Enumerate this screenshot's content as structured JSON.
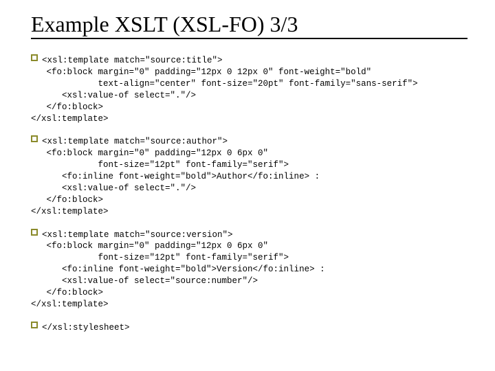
{
  "title": "Example XSLT (XSL-FO) 3/3",
  "blocks": [
    {
      "lines": [
        "<xsl:template match=\"source:title\">",
        "   <fo:block margin=\"0\" padding=\"12px 0 12px 0\" font-weight=\"bold\"",
        "             text-align=\"center\" font-size=\"20pt\" font-family=\"sans-serif\">",
        "      <xsl:value-of select=\".\"/>",
        "   </fo:block>",
        "</xsl:template>"
      ]
    },
    {
      "lines": [
        "<xsl:template match=\"source:author\">",
        "   <fo:block margin=\"0\" padding=\"12px 0 6px 0\"",
        "             font-size=\"12pt\" font-family=\"serif\">",
        "      <fo:inline font-weight=\"bold\">Author</fo:inline> :",
        "      <xsl:value-of select=\".\"/>",
        "   </fo:block>",
        "</xsl:template>"
      ]
    },
    {
      "lines": [
        "<xsl:template match=\"source:version\">",
        "   <fo:block margin=\"0\" padding=\"12px 0 6px 0\"",
        "             font-size=\"12pt\" font-family=\"serif\">",
        "      <fo:inline font-weight=\"bold\">Version</fo:inline> :",
        "      <xsl:value-of select=\"source:number\"/>",
        "   </fo:block>",
        "</xsl:template>"
      ]
    },
    {
      "lines": [
        "</xsl:stylesheet>"
      ]
    }
  ]
}
